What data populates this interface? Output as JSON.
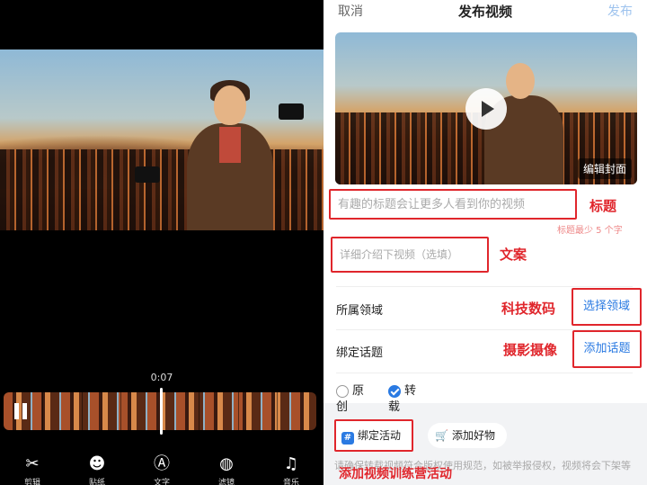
{
  "editor": {
    "timecode": "0:07",
    "tools": [
      {
        "icon": "scissors-icon",
        "glyph": "✂",
        "label": "剪辑"
      },
      {
        "icon": "sticker-icon",
        "glyph": "☻",
        "label": "贴纸"
      },
      {
        "icon": "text-icon",
        "glyph": "Ⓐ",
        "label": "文字"
      },
      {
        "icon": "filter-icon",
        "glyph": "◍",
        "label": "滤镜"
      },
      {
        "icon": "music-icon",
        "glyph": "♫",
        "label": "音乐"
      }
    ]
  },
  "publish": {
    "cancel": "取消",
    "title": "发布视频",
    "publish": "发布",
    "edit_cover": "编辑封面",
    "title_placeholder": "有趣的标题会让更多人看到你的视频",
    "title_tag": "标题",
    "title_hint": "标题最少 5 个字",
    "desc_placeholder": "详细介绍下视频（选填）",
    "desc_tag": "文案",
    "domain_label": "所属领域",
    "domain_tag": "科技数码",
    "domain_action": "选择领域",
    "topic_label": "绑定话题",
    "topic_tag": "摄影摄像",
    "topic_action": "添加话题",
    "radio_original": "原创",
    "radio_repost": "转载",
    "activity_btn": "绑定活动",
    "goods_btn": "添加好物",
    "activity_tag": "添加视频训练营活动",
    "notice": "请确保转载视频符合版权使用规范，如被举报侵权，视频将会下架等"
  },
  "colors": {
    "annotation_red": "#e0262c",
    "link_blue": "#2a7ae2"
  }
}
